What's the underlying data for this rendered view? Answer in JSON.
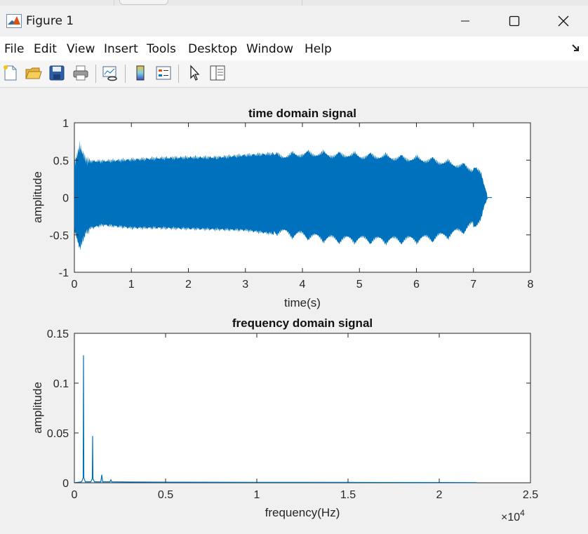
{
  "window": {
    "title": "Figure 1",
    "icon": "matlab-logo-icon"
  },
  "menu": [
    "File",
    "Edit",
    "View",
    "Insert",
    "Tools",
    "Desktop",
    "Window",
    "Help"
  ],
  "toolbar": {
    "icons": [
      "new-figure-icon",
      "open-file-icon",
      "save-icon",
      "print-icon",
      "link-plot-icon",
      "colorbar-icon",
      "legend-icon",
      "edit-plot-arrow-icon",
      "property-inspector-icon"
    ]
  },
  "chart_data": [
    {
      "type": "line",
      "title": "time domain signal",
      "xlabel": "time(s)",
      "ylabel": "amplitude",
      "xlim": [
        0,
        8
      ],
      "ylim": [
        -1,
        1
      ],
      "xticks": [
        "0",
        "1",
        "2",
        "3",
        "4",
        "5",
        "6",
        "7",
        "8"
      ],
      "yticks": [
        "1",
        "0.5",
        "0",
        "-0.5",
        "-1"
      ],
      "color": "#0072BD",
      "envelope": {
        "t": [
          0,
          0.05,
          0.1,
          0.15,
          0.2,
          0.3,
          0.5,
          1,
          1.5,
          2,
          2.5,
          3,
          3.5,
          3.8,
          4,
          4.3,
          4.6,
          4.8,
          5,
          5.3,
          5.6,
          6,
          6.3,
          6.6,
          6.8,
          7,
          7.1,
          7.15,
          7.2,
          7.25
        ],
        "upper": [
          0.45,
          0.6,
          0.7,
          0.6,
          0.52,
          0.5,
          0.5,
          0.52,
          0.54,
          0.55,
          0.55,
          0.58,
          0.6,
          0.61,
          0.63,
          0.63,
          0.61,
          0.62,
          0.6,
          0.6,
          0.58,
          0.56,
          0.54,
          0.5,
          0.47,
          0.42,
          0.38,
          0.3,
          0.15,
          0.02
        ],
        "lower": [
          -0.4,
          -0.55,
          -0.66,
          -0.55,
          -0.45,
          -0.42,
          -0.38,
          -0.42,
          -0.42,
          -0.43,
          -0.44,
          -0.45,
          -0.5,
          -0.55,
          -0.56,
          -0.6,
          -0.62,
          -0.62,
          -0.62,
          -0.63,
          -0.63,
          -0.62,
          -0.6,
          -0.55,
          -0.5,
          -0.42,
          -0.35,
          -0.25,
          -0.1,
          -0.02
        ]
      }
    },
    {
      "type": "line",
      "title": "frequency domain signal",
      "xlabel": "frequency(Hz)",
      "ylabel": "amplitude",
      "xlim": [
        0,
        25000
      ],
      "ylim": [
        0,
        0.15
      ],
      "xticks": [
        "0",
        "0.5",
        "1",
        "1.5",
        "2",
        "2.5"
      ],
      "yticks": [
        "0.15",
        "0.1",
        "0.05",
        "0"
      ],
      "exponent_label": "×10",
      "exponent": "4",
      "color": "#0072BD",
      "x": [
        0,
        400,
        480,
        500,
        520,
        600,
        900,
        980,
        1000,
        1020,
        1100,
        1450,
        1500,
        1550,
        1950,
        2000,
        2050,
        3000,
        5000,
        10000,
        15000,
        20000,
        22050
      ],
      "y": [
        0,
        0.001,
        0.005,
        0.128,
        0.005,
        0.001,
        0.001,
        0.004,
        0.047,
        0.004,
        0.001,
        0.001,
        0.008,
        0.001,
        0.001,
        0.003,
        0.001,
        0.0008,
        0.0006,
        0.0005,
        0.0004,
        0.0003,
        0.0002
      ]
    }
  ]
}
